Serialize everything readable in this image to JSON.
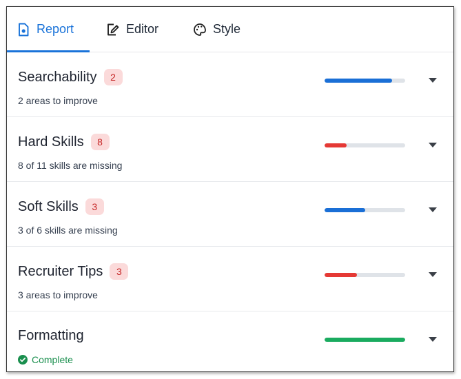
{
  "tabs": [
    {
      "label": "Report",
      "icon": "report-icon",
      "active": true
    },
    {
      "label": "Editor",
      "icon": "editor-icon",
      "active": false
    },
    {
      "label": "Style",
      "icon": "palette-icon",
      "active": false
    }
  ],
  "colors": {
    "accent": "#1a73d9",
    "danger": "#e53935",
    "success": "#1aab5f",
    "badge_bg": "#fbdada",
    "badge_text": "#c62828",
    "track": "#dfe3e8"
  },
  "sections": [
    {
      "title": "Searchability",
      "badge": "2",
      "subtitle": "2 areas to improve",
      "progress": 0.84,
      "bar_color": "#1a6fd6",
      "complete": false
    },
    {
      "title": "Hard Skills",
      "badge": "8",
      "subtitle": "8 of 11 skills are missing",
      "progress": 0.27,
      "bar_color": "#e53935",
      "complete": false
    },
    {
      "title": "Soft Skills",
      "badge": "3",
      "subtitle": "3 of 6 skills are missing",
      "progress": 0.5,
      "bar_color": "#1a6fd6",
      "complete": false
    },
    {
      "title": "Recruiter Tips",
      "badge": "3",
      "subtitle": "3 areas to improve",
      "progress": 0.4,
      "bar_color": "#e53935",
      "complete": false
    },
    {
      "title": "Formatting",
      "badge": "",
      "subtitle": "Complete",
      "progress": 1.0,
      "bar_color": "#1aab5f",
      "complete": true
    }
  ]
}
